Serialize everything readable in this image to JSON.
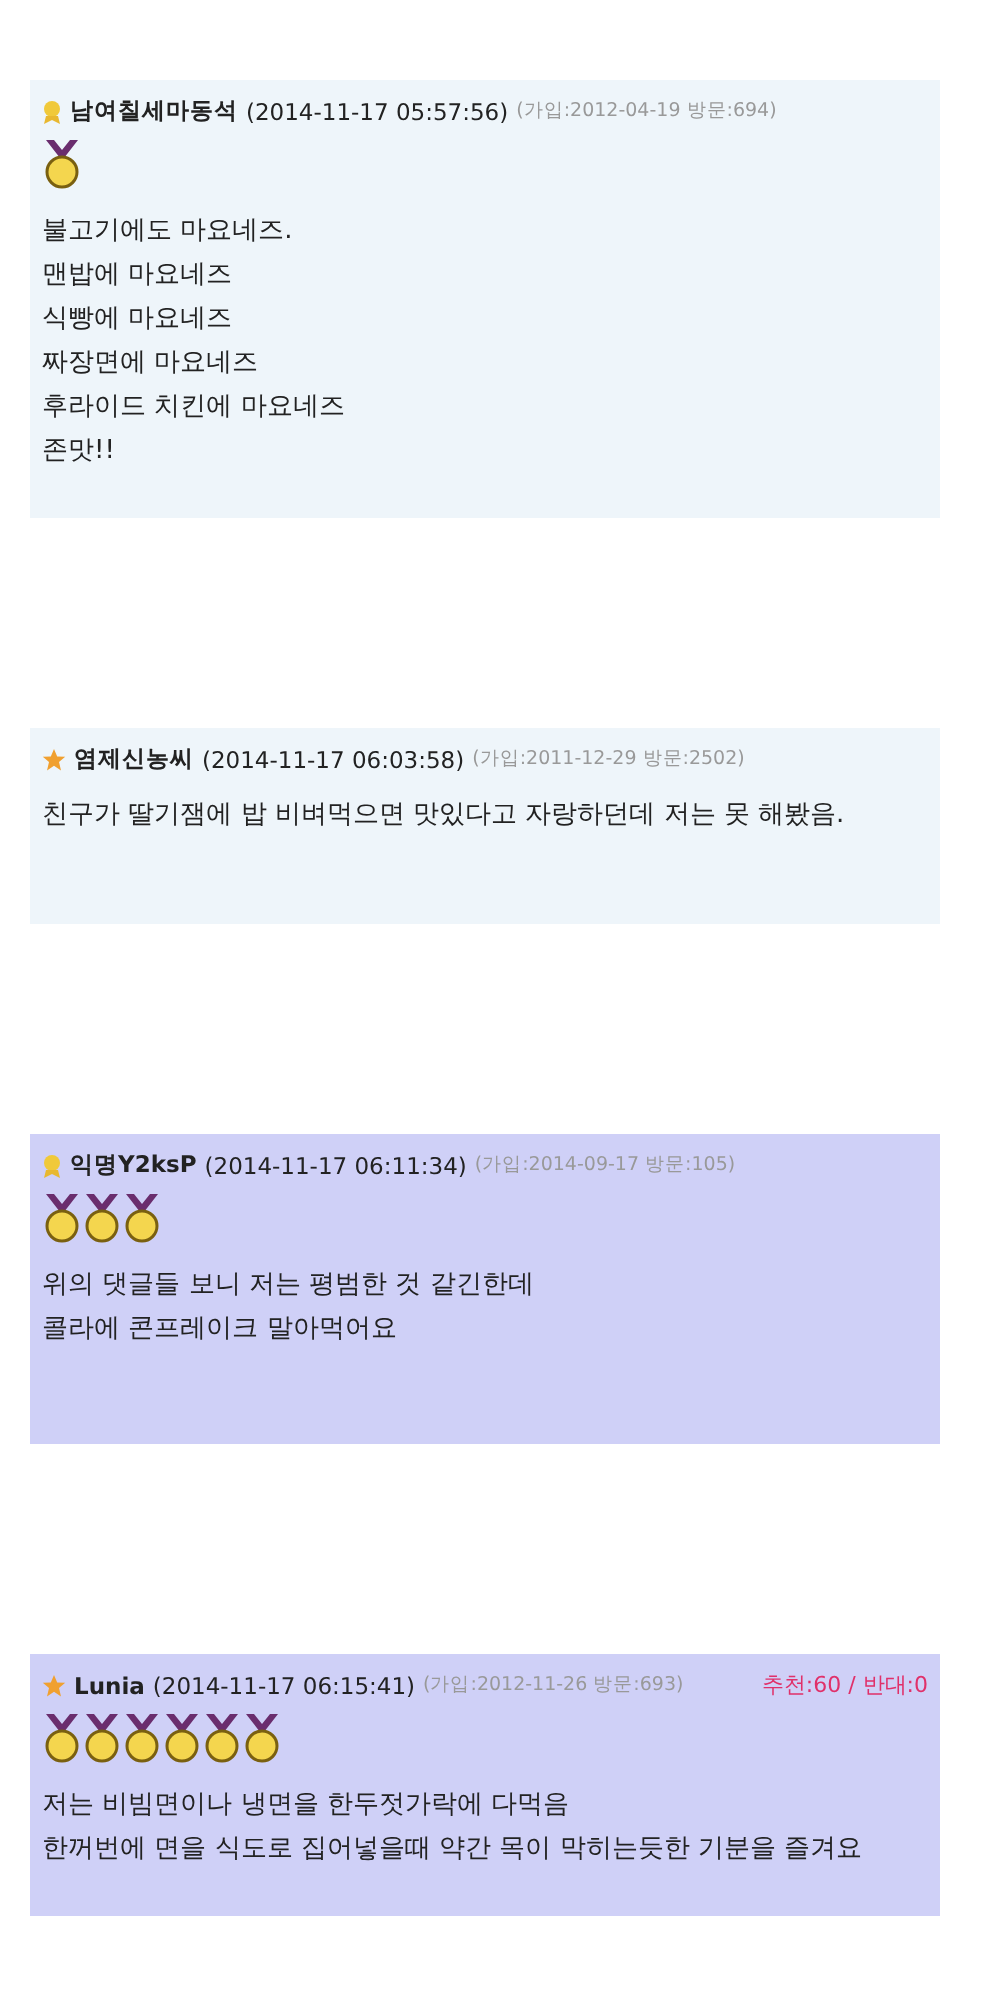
{
  "comments": [
    {
      "kind": "medal",
      "author": "남여칠세마동석",
      "time": "(2014-11-17 05:57:56)",
      "meta": "(가입:2012-04-19 방문:694)",
      "color": "#eef5fa",
      "medals": [
        {
          "kind": "gold"
        }
      ],
      "lines": [
        "불고기에도 마요네즈.",
        "맨밥에 마요네즈",
        "식빵에 마요네즈",
        "짜장면에 마요네즈",
        "후라이드 치킨에 마요네즈",
        "존맛!!"
      ]
    },
    {
      "kind": "star",
      "author": "염제신농씨",
      "time": "(2014-11-17 06:03:58)",
      "meta": "(가입:2011-12-29 방문:2502)",
      "color": "#eef5fa",
      "lines": [
        "친구가 딸기잼에 밥 비벼먹으면 맛있다고 자랑하던데 저는 못 해봤음."
      ]
    },
    {
      "kind": "medal",
      "author": "익명Y2ksP",
      "time": "(2014-11-17 06:11:34)",
      "meta": "(가입:2014-09-17 방문:105)",
      "color": "#cfd0f7",
      "medals": [
        {
          "kind": "gold"
        },
        {
          "kind": "gold"
        },
        {
          "kind": "gold"
        }
      ],
      "lines": [
        "위의 댓글들 보니 저는 평범한 것 같긴한데",
        "콜라에 콘프레이크 말아먹어요"
      ]
    },
    {
      "kind": "star",
      "author": "Lunia",
      "time": "(2014-11-17 06:15:41)",
      "meta": "(가입:2012-11-26 방문:693)",
      "votes": "추천:60 / 반대:0",
      "color": "#cfd0f7",
      "medals": [
        {
          "kind": "gold"
        },
        {
          "kind": "gold"
        },
        {
          "kind": "gold"
        },
        {
          "kind": "gold"
        },
        {
          "kind": "gold"
        },
        {
          "kind": "gold"
        }
      ],
      "lines": [
        "저는 비빔면이나 냉면을 한두젓가락에 다먹음",
        "한꺼번에 면을 식도로 집어넣을때 약간 목이 막히는듯한 기분을 즐겨요"
      ]
    }
  ]
}
